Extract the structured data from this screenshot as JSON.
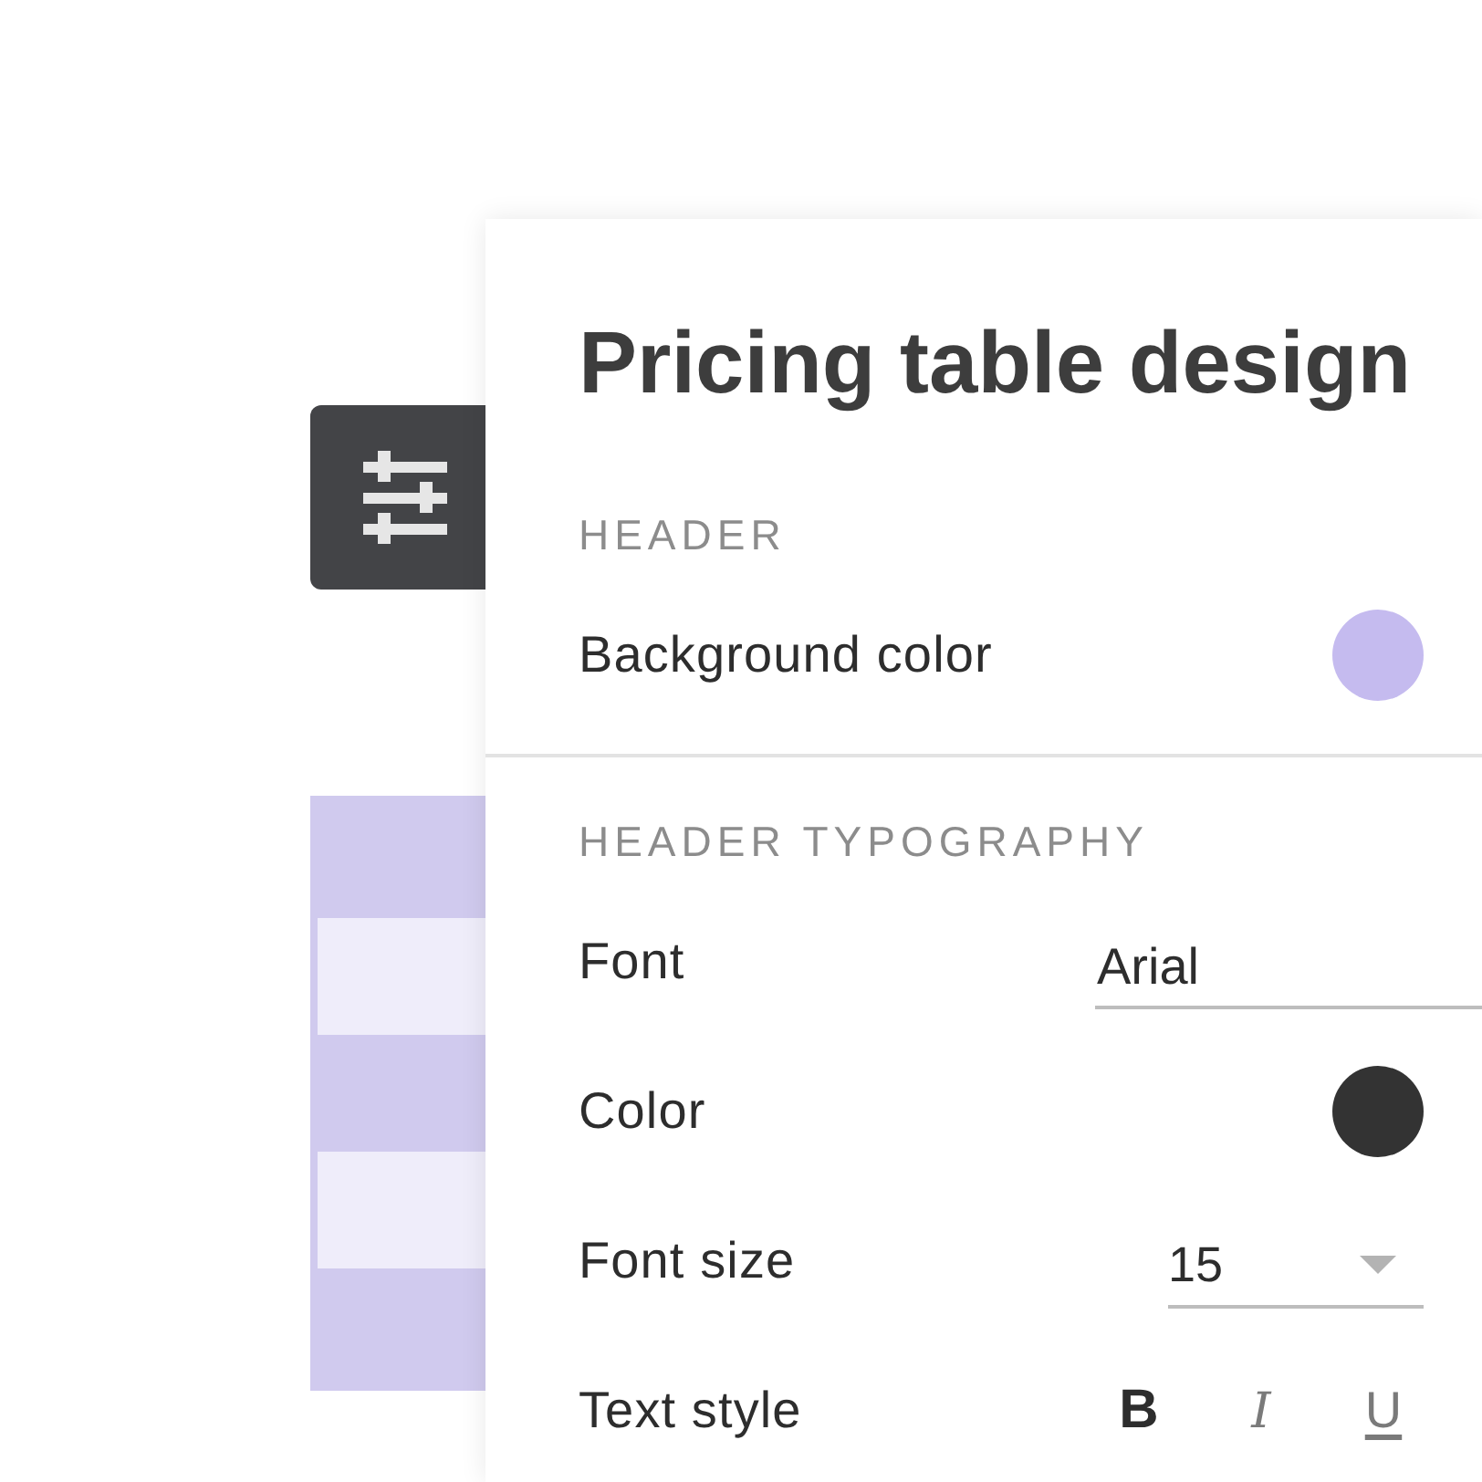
{
  "panel": {
    "title": "Pricing table design",
    "sections": [
      {
        "heading": "HEADER",
        "rows": [
          {
            "kind": "color",
            "label": "Background color",
            "color": "#c5bbef"
          }
        ]
      },
      {
        "heading": "HEADER TYPOGRAPHY",
        "rows": [
          {
            "kind": "text",
            "label": "Font",
            "value": "Arial"
          },
          {
            "kind": "color",
            "label": "Color",
            "color": "#333333"
          },
          {
            "kind": "select",
            "label": "Font size",
            "value": "15"
          },
          {
            "kind": "styles",
            "label": "Text style",
            "options": [
              {
                "kind": "bold",
                "label": "B",
                "selected": true
              },
              {
                "kind": "italic",
                "label": "I",
                "selected": false
              },
              {
                "kind": "underline",
                "label": "U",
                "selected": false
              }
            ]
          }
        ]
      }
    ]
  }
}
